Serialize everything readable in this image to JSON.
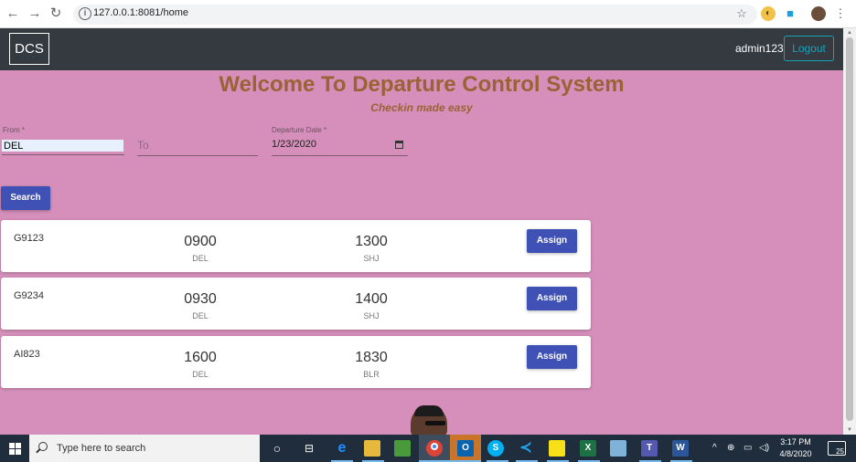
{
  "browser": {
    "url": "127.0.0.1:8081/home"
  },
  "navbar": {
    "brand": "DCS",
    "username": "admin123",
    "logout_label": "Logout"
  },
  "hero": {
    "title": "Welcome To Departure Control System",
    "subtitle": "Checkin made easy"
  },
  "form": {
    "from_label": "From *",
    "from_value": "DEL",
    "to_placeholder": "To",
    "date_label": "Departure Date *",
    "date_value": "1/23/2020",
    "search_label": "Search"
  },
  "flights": [
    {
      "number": "G9123",
      "dep_time": "0900",
      "dep_city": "DEL",
      "arr_time": "1300",
      "arr_city": "SHJ",
      "action": "Assign"
    },
    {
      "number": "G9234",
      "dep_time": "0930",
      "dep_city": "DEL",
      "arr_time": "1400",
      "arr_city": "SHJ",
      "action": "Assign"
    },
    {
      "number": "AI823",
      "dep_time": "1600",
      "dep_city": "DEL",
      "arr_time": "1830",
      "arr_city": "BLR",
      "action": "Assign"
    }
  ],
  "taskbar": {
    "search_placeholder": "Type here to search",
    "time": "3:17 PM",
    "date": "4/8/2020",
    "notification_count": "25"
  },
  "colors": {
    "navbar_bg": "#343a40",
    "page_bg": "#d58fba",
    "title_color": "#9a6236",
    "primary_button": "#3f51b5",
    "logout_outline": "#17a2b8"
  }
}
